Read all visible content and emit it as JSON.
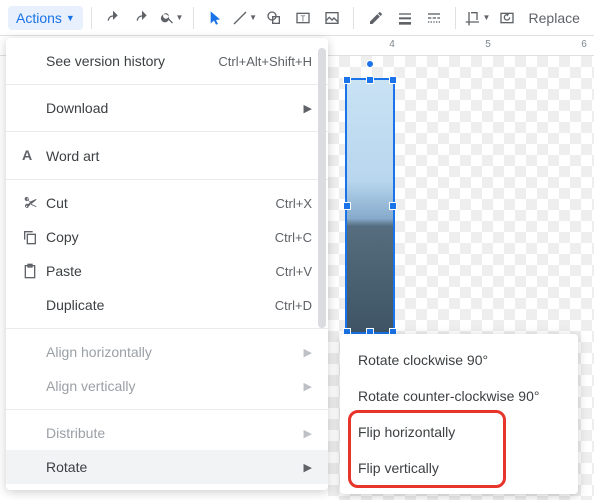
{
  "toolbar": {
    "actions_label": "Actions",
    "replace_label": "Replace"
  },
  "ruler": {
    "t4": "4",
    "t5": "5",
    "t6": "6"
  },
  "menu": {
    "version_history": "See version history",
    "version_history_sc": "Ctrl+Alt+Shift+H",
    "download": "Download",
    "word_art": "Word art",
    "cut": "Cut",
    "cut_sc": "Ctrl+X",
    "copy": "Copy",
    "copy_sc": "Ctrl+C",
    "paste": "Paste",
    "paste_sc": "Ctrl+V",
    "duplicate": "Duplicate",
    "duplicate_sc": "Ctrl+D",
    "align_h": "Align horizontally",
    "align_v": "Align vertically",
    "distribute": "Distribute",
    "rotate": "Rotate"
  },
  "submenu": {
    "cw": "Rotate clockwise 90°",
    "ccw": "Rotate counter-clockwise 90°",
    "flip_h": "Flip horizontally",
    "flip_v": "Flip vertically"
  }
}
